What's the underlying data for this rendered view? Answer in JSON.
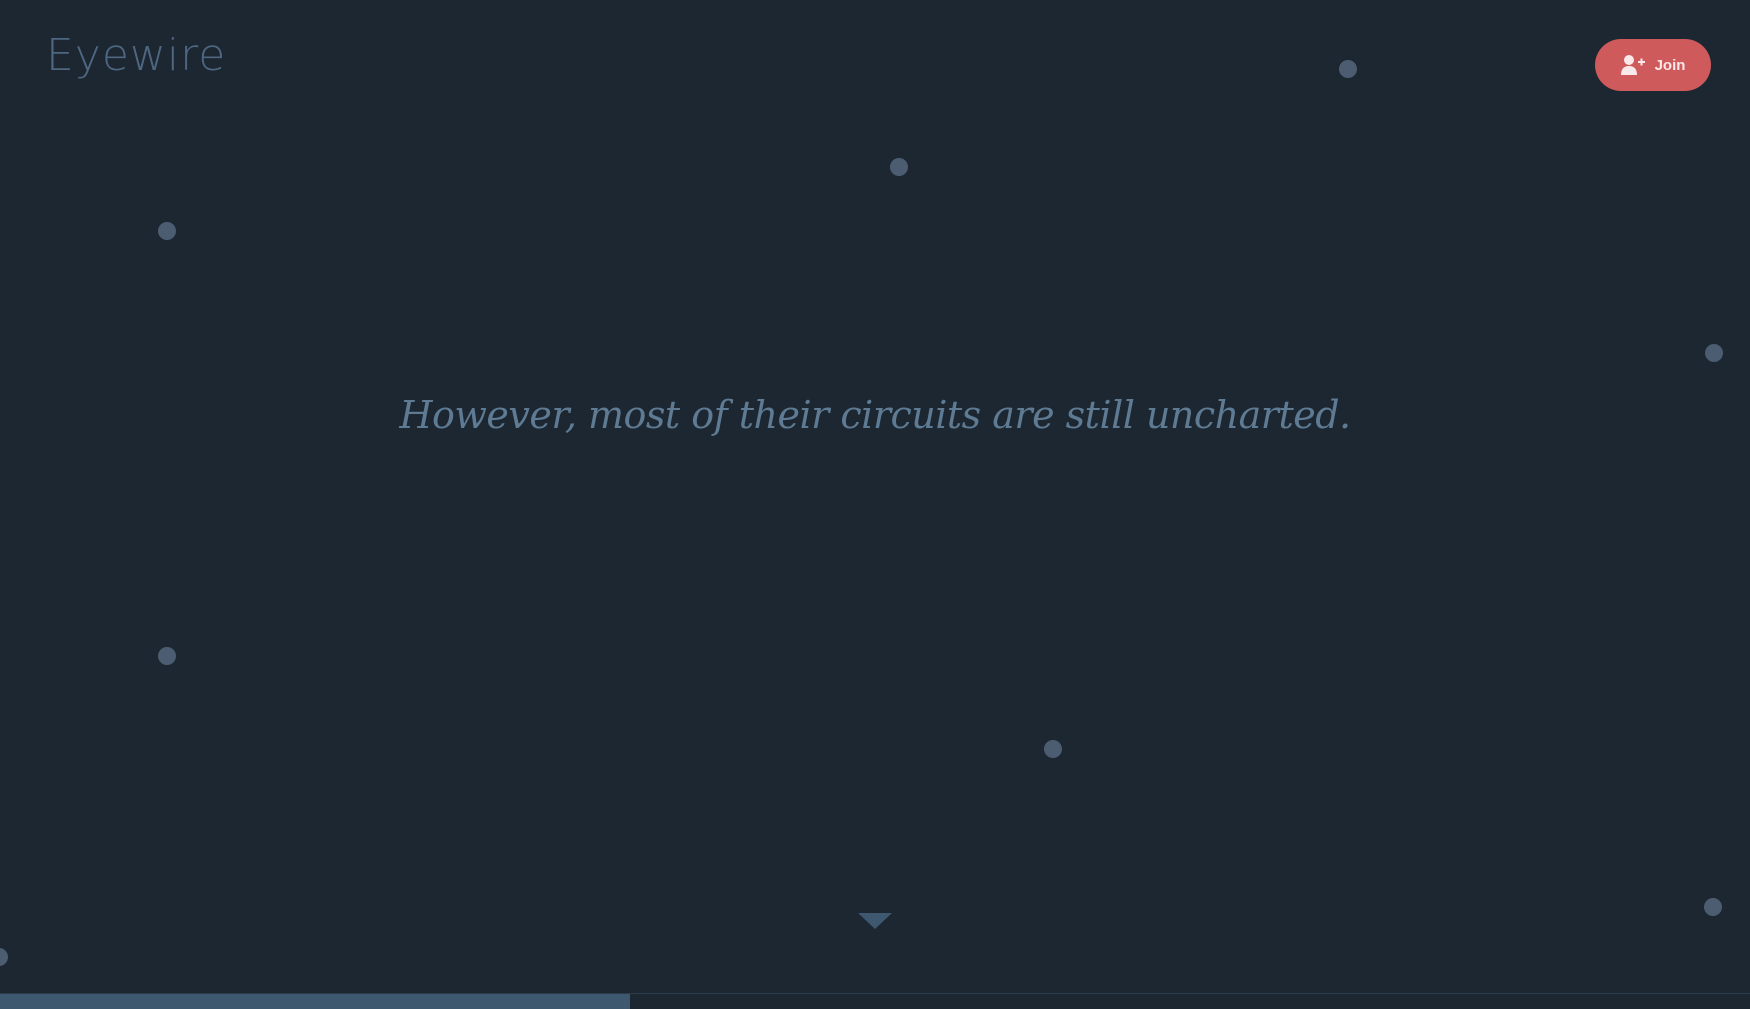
{
  "header": {
    "logo_text": "Eyewire",
    "join_button": {
      "label": "Join",
      "icon": "user-plus-icon"
    }
  },
  "main": {
    "tagline": "However, most of their circuits are still uncharted."
  },
  "scroll_indicator": {
    "icon": "chevron-down-icon"
  },
  "progress": {
    "fraction": 0.36
  },
  "colors": {
    "background": "#1c2732",
    "accent": "#cf5a5b",
    "logo": "#4f6681",
    "tagline": "#5e7b93",
    "dot": "#4c5d72",
    "progress": "#3e5870"
  }
}
